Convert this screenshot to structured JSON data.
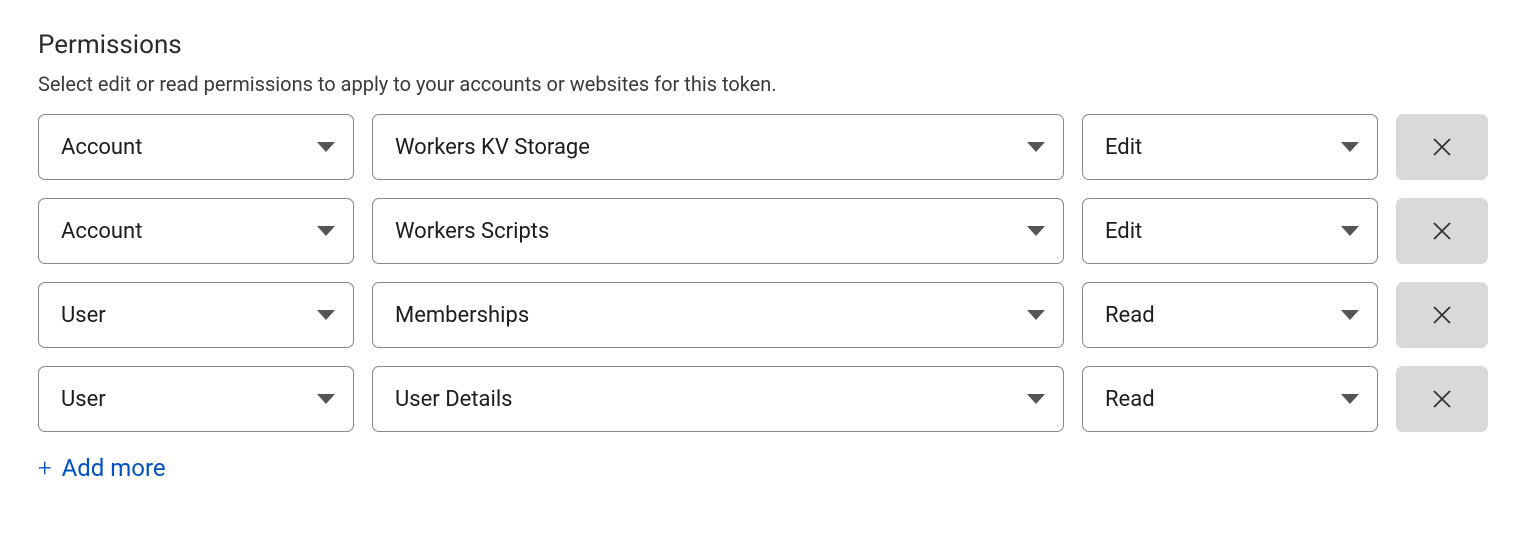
{
  "section": {
    "title": "Permissions",
    "description": "Select edit or read permissions to apply to your accounts or websites for this token."
  },
  "rows": [
    {
      "scope": "Account",
      "resource": "Workers KV Storage",
      "access": "Edit"
    },
    {
      "scope": "Account",
      "resource": "Workers Scripts",
      "access": "Edit"
    },
    {
      "scope": "User",
      "resource": "Memberships",
      "access": "Read"
    },
    {
      "scope": "User",
      "resource": "User Details",
      "access": "Read"
    }
  ],
  "actions": {
    "add_more": "Add more"
  }
}
